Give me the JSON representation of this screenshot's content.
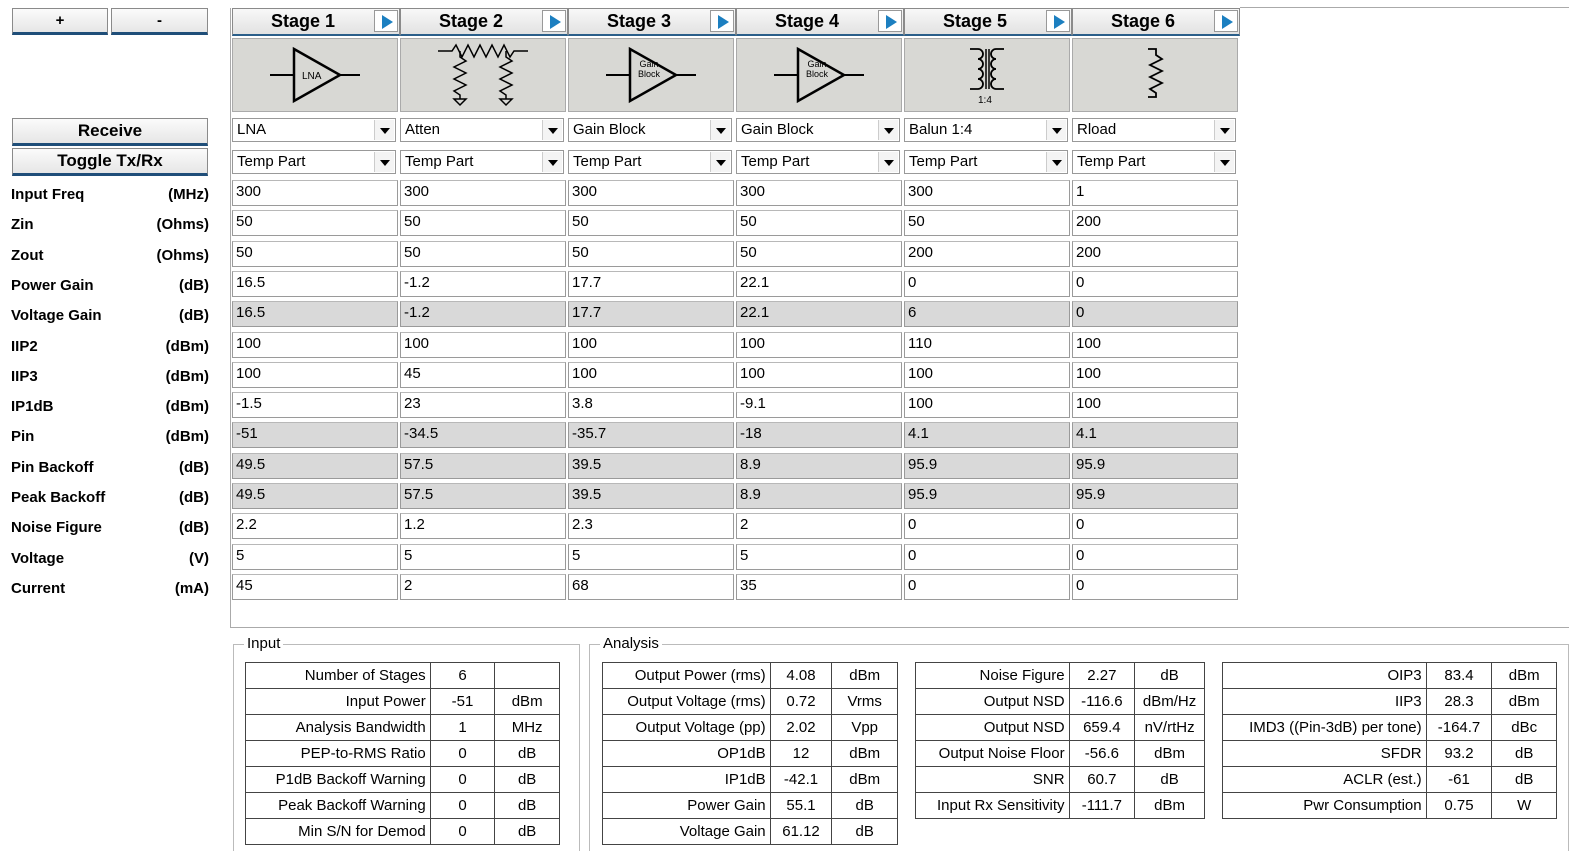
{
  "controls": {
    "add": "+",
    "remove": "-",
    "receive": "Receive",
    "toggle": "Toggle Tx/Rx"
  },
  "rows": [
    {
      "label": "Input Freq",
      "unit": "(MHz)"
    },
    {
      "label": "Zin",
      "unit": "(Ohms)"
    },
    {
      "label": "Zout",
      "unit": "(Ohms)"
    },
    {
      "label": "Power Gain",
      "unit": "(dB)"
    },
    {
      "label": "Voltage Gain",
      "unit": "(dB)"
    },
    {
      "label": "IIP2",
      "unit": "(dBm)"
    },
    {
      "label": "IIP3",
      "unit": "(dBm)"
    },
    {
      "label": "IP1dB",
      "unit": "(dBm)"
    },
    {
      "label": "Pin",
      "unit": "(dBm)"
    },
    {
      "label": "Pin Backoff",
      "unit": "(dB)"
    },
    {
      "label": "Peak Backoff",
      "unit": "(dB)"
    },
    {
      "label": "Noise Figure",
      "unit": "(dB)"
    },
    {
      "label": "Voltage",
      "unit": "(V)"
    },
    {
      "label": "Current",
      "unit": "(mA)"
    }
  ],
  "stages": [
    {
      "title": "Stage 1",
      "icon": "lna-icon",
      "icon_text": "LNA",
      "part": "LNA",
      "temp": "Temp Part",
      "values": [
        "300",
        "50",
        "50",
        "16.5",
        "16.5",
        "100",
        "100",
        "-1.5",
        "-51",
        "49.5",
        "49.5",
        "2.2",
        "5",
        "45"
      ]
    },
    {
      "title": "Stage 2",
      "icon": "attenuator-icon",
      "icon_text": "",
      "part": "Atten",
      "temp": "Temp Part",
      "values": [
        "300",
        "50",
        "50",
        "-1.2",
        "-1.2",
        "100",
        "45",
        "23",
        "-34.5",
        "57.5",
        "57.5",
        "1.2",
        "5",
        "2"
      ]
    },
    {
      "title": "Stage 3",
      "icon": "gain-block-icon",
      "icon_text": "Gain Block",
      "part": "Gain Block",
      "temp": "Temp Part",
      "values": [
        "300",
        "50",
        "50",
        "17.7",
        "17.7",
        "100",
        "100",
        "3.8",
        "-35.7",
        "39.5",
        "39.5",
        "2.3",
        "5",
        "68"
      ]
    },
    {
      "title": "Stage 4",
      "icon": "gain-block-icon",
      "icon_text": "Gain Block",
      "part": "Gain Block",
      "temp": "Temp Part",
      "values": [
        "300",
        "50",
        "50",
        "22.1",
        "22.1",
        "100",
        "100",
        "-9.1",
        "-18",
        "8.9",
        "8.9",
        "2",
        "5",
        "35"
      ]
    },
    {
      "title": "Stage 5",
      "icon": "balun-icon",
      "icon_text": "1:4",
      "part": "Balun 1:4",
      "temp": "Temp Part",
      "values": [
        "300",
        "50",
        "200",
        "0",
        "6",
        "110",
        "100",
        "100",
        "4.1",
        "95.9",
        "95.9",
        "0",
        "0",
        "0"
      ]
    },
    {
      "title": "Stage 6",
      "icon": "resistor-load-icon",
      "icon_text": "",
      "part": "Rload",
      "temp": "Temp Part",
      "values": [
        "1",
        "200",
        "200",
        "0",
        "0",
        "100",
        "100",
        "100",
        "4.1",
        "95.9",
        "95.9",
        "0",
        "0",
        "0"
      ]
    }
  ],
  "input": {
    "legend": "Input",
    "rows": [
      {
        "label": "Number of Stages",
        "value": "6",
        "unit": ""
      },
      {
        "label": "Input Power",
        "value": "-51",
        "unit": "dBm"
      },
      {
        "label": "Analysis Bandwidth",
        "value": "1",
        "unit": "MHz"
      },
      {
        "label": "PEP-to-RMS Ratio",
        "value": "0",
        "unit": "dB"
      },
      {
        "label": "P1dB Backoff Warning",
        "value": "0",
        "unit": "dB"
      },
      {
        "label": "Peak Backoff Warning",
        "value": "0",
        "unit": "dB"
      },
      {
        "label": "Min S/N for Demod",
        "value": "0",
        "unit": "dB"
      }
    ]
  },
  "analysis": {
    "legend": "Analysis",
    "table1": [
      {
        "label": "Output Power (rms)",
        "value": "4.08",
        "unit": "dBm"
      },
      {
        "label": "Output Voltage (rms)",
        "value": "0.72",
        "unit": "Vrms"
      },
      {
        "label": "Output Voltage (pp)",
        "value": "2.02",
        "unit": "Vpp"
      },
      {
        "label": "OP1dB",
        "value": "12",
        "unit": "dBm"
      },
      {
        "label": "IP1dB",
        "value": "-42.1",
        "unit": "dBm"
      },
      {
        "label": "Power Gain",
        "value": "55.1",
        "unit": "dB"
      },
      {
        "label": "Voltage Gain",
        "value": "61.12",
        "unit": "dB"
      }
    ],
    "table2": [
      {
        "label": "Noise Figure",
        "value": "2.27",
        "unit": "dB"
      },
      {
        "label": "Output NSD",
        "value": "-116.6",
        "unit": "dBm/Hz"
      },
      {
        "label": "Output NSD",
        "value": "659.4",
        "unit": "nV/rtHz"
      },
      {
        "label": "Output Noise Floor",
        "value": "-56.6",
        "unit": "dBm"
      },
      {
        "label": "SNR",
        "value": "60.7",
        "unit": "dB"
      },
      {
        "label": "Input Rx Sensitivity",
        "value": "-111.7",
        "unit": "dBm"
      }
    ],
    "table3": [
      {
        "label": "OIP3",
        "value": "83.4",
        "unit": "dBm"
      },
      {
        "label": "IIP3",
        "value": "28.3",
        "unit": "dBm"
      },
      {
        "label": "IMD3 ((Pin-3dB) per tone)",
        "value": "-164.7",
        "unit": "dBc"
      },
      {
        "label": "SFDR",
        "value": "93.2",
        "unit": "dB"
      },
      {
        "label": "ACLR (est.)",
        "value": "-61",
        "unit": "dB"
      },
      {
        "label": "Pwr Consumption",
        "value": "0.75",
        "unit": "W"
      }
    ]
  }
}
